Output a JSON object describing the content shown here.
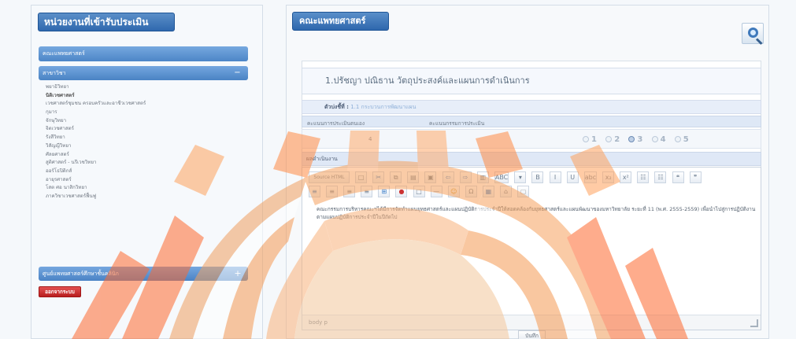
{
  "sidebar": {
    "title": "หน่วยงานที่เข้ารับประเมิน",
    "top_item": "คณะแพทยศาสตร์",
    "active_item": "สาขาวิชา",
    "items": [
      "พยาธิวิทยา",
      "นิติเวชศาสตร์",
      "เวชศาสตร์ชุมชน ครอบครัวและอาชีวเวชศาสตร์",
      "กุมาร",
      "จักษุวิทยา",
      "จิตเวชศาสตร์",
      "รังสีวิทยา",
      "วิสัญญีวิทยา",
      "ศัลยศาสตร์",
      "สูติศาสตร์ - นรีเวชวิทยา",
      "ออร์โธปิดิกส์",
      "อายุรศาสตร์",
      "โสต ศอ นาสิกวิทยา",
      "ภาควิชาเวชศาสตร์ฟื้นฟู"
    ],
    "bottom_item": "ศูนย์แพทยศาสตร์ศึกษาชั้นคลินิก",
    "logout_label": "ออกจากระบบ"
  },
  "main": {
    "title": "คณะแพทยศาสตร์",
    "question_title": "1.ปรัชญา ปณิธาน วัตถุประสงค์และแผนการดำเนินการ",
    "indicator_label": "ตัวบ่งชี้ที่ :",
    "indicator_value": "1.1 กระบวนการพัฒนาแผน",
    "self_assessment_label": "คะแนนการประเมินตนเอง",
    "committee_assessment_label": "คะแนนกรรมการประเมิน",
    "self_score": "4",
    "rating_options": [
      "1",
      "2",
      "3",
      "4",
      "5"
    ],
    "result_header": "ผลดำเนินงาน",
    "toolbar": {
      "source_label": "Source HTML",
      "buttons_row1": [
        "□",
        "✂",
        "⧉",
        "▤",
        "▣",
        "⇦",
        "⇨",
        "▥",
        "ABC",
        "▾",
        "B",
        "I",
        "U",
        "abc",
        "x₂",
        "x²",
        "☷",
        "☷",
        "❝",
        "❞"
      ],
      "buttons_row2": [
        "≡",
        "≡",
        "≡",
        "≡",
        "⊞",
        "●",
        "□",
        "—",
        "☺",
        "Ω",
        "▦",
        "⌂",
        "▢"
      ]
    },
    "body_text": "คณะกรรมการบริหารคณะฯได้มีการจัดทำแผนยุทธศาสตร์และแผนปฏิบัติการประจำปีให้สอดคล้องกับยุทธศาสตร์และแผนพัฒนาของมหาวิทยาลัย ระยะที่ 11 (พ.ศ. 2555-2559) เพื่อนำไปสู่การปฏิบัติงานตามแผนปฏิบัติการประจำปีในปีถัดไป",
    "status_bar": "body  p",
    "save_label": "บันทึก"
  }
}
